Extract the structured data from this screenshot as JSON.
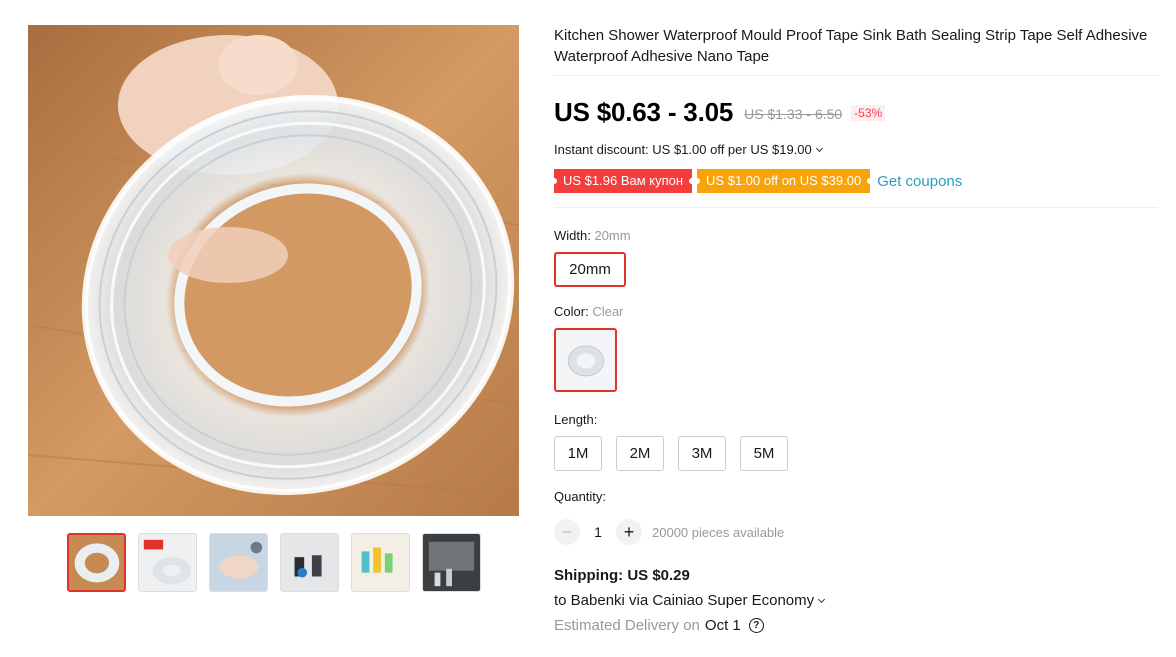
{
  "product": {
    "title": "Kitchen Shower Waterproof Mould Proof Tape Sink Bath Sealing Strip Tape Self Adhesive Waterproof Adhesive Nano Tape",
    "price": "US $0.63 - 3.05",
    "original_price": "US $1.33 - 6.50",
    "discount_percent": "-53%"
  },
  "promotions": {
    "instant_discount": "Instant discount: US $1.00 off per US $19.00",
    "coupons": [
      "US $1.96 Вам купон",
      "US $1.00 off on US $39.00"
    ],
    "get_coupons_label": "Get coupons"
  },
  "sku": {
    "width": {
      "label": "Width:",
      "selected": "20mm",
      "options": [
        "20mm"
      ]
    },
    "color": {
      "label": "Color:",
      "selected": "Clear"
    },
    "length": {
      "label": "Length:",
      "options": [
        "1M",
        "2M",
        "3M",
        "5M"
      ]
    }
  },
  "quantity": {
    "label": "Quantity:",
    "value": "1",
    "minus": "−",
    "plus": "+",
    "available": "20000 pieces available"
  },
  "shipping": {
    "cost": "Shipping: US $0.29",
    "destination": "to Babenki via Cainiao Super Economy",
    "estimated_label": "Estimated Delivery on",
    "estimated_date": "Oct 1",
    "help_icon": "?"
  },
  "gallery": {
    "thumbnail_count": 6,
    "active_index": 0,
    "colors": {
      "wood": "#c98d55",
      "tape": "#e8eef2",
      "accent_red": "#e0332b"
    }
  },
  "icons": {
    "dropdown": "chevron-down-icon",
    "help": "question-circle-icon"
  }
}
